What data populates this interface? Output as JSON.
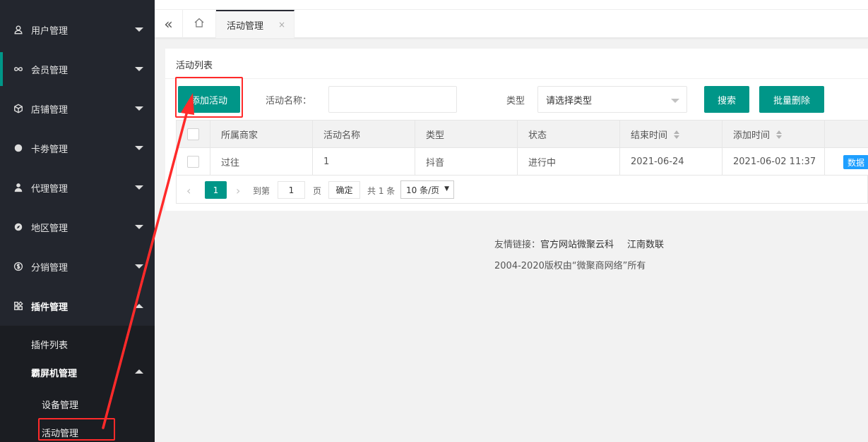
{
  "sidebar": {
    "items": [
      {
        "label": "用户管理",
        "icon": "user-icon"
      },
      {
        "label": "会员管理",
        "icon": "infinity-icon"
      },
      {
        "label": "店铺管理",
        "icon": "cube-icon"
      },
      {
        "label": "卡劵管理",
        "icon": "circle-icon"
      },
      {
        "label": "代理管理",
        "icon": "person-icon"
      },
      {
        "label": "地区管理",
        "icon": "compass-icon"
      },
      {
        "label": "分销管理",
        "icon": "dollar-icon"
      },
      {
        "label": "插件管理",
        "icon": "apps-icon"
      }
    ],
    "submenu": {
      "plugin_list": "插件列表",
      "screen_machine": "霸屏机管理",
      "device_manage": "设备管理",
      "activity_manage": "活动管理"
    }
  },
  "tabs": {
    "active_label": "活动管理",
    "close_glyph": "×",
    "collapse_glyph": "«"
  },
  "card": {
    "title": "活动列表",
    "add_button": "添加活动",
    "name_label": "活动名称：",
    "name_value": "",
    "type_label": "类型",
    "type_placeholder": "请选择类型",
    "search_button": "搜索",
    "batch_delete_button": "批量删除"
  },
  "table": {
    "headers": [
      "所属商家",
      "活动名称",
      "类型",
      "状态",
      "结束时间",
      "添加时间"
    ],
    "rows": [
      {
        "merchant": "过往",
        "name": "1",
        "type": "抖音",
        "status": "进行中",
        "end_time": "2021-06-24",
        "add_time": "2021-06-02 11:37",
        "action": "数据"
      }
    ]
  },
  "pager": {
    "current": "1",
    "goto_label": "到第",
    "goto_value": "1",
    "page_label": "页",
    "confirm": "确定",
    "total": "共 1 条",
    "page_size": "10 条/页"
  },
  "footer": {
    "links_label": "友情链接：",
    "link1": "官方网站微聚云科",
    "link2": "江南数联",
    "copyright": "2004-2020版权由“微聚商网络”所有"
  },
  "colors": {
    "accent": "#009688",
    "sidebar_bg": "#23262e",
    "annotation": "#ff2a2a",
    "badge": "#1e9fff"
  }
}
